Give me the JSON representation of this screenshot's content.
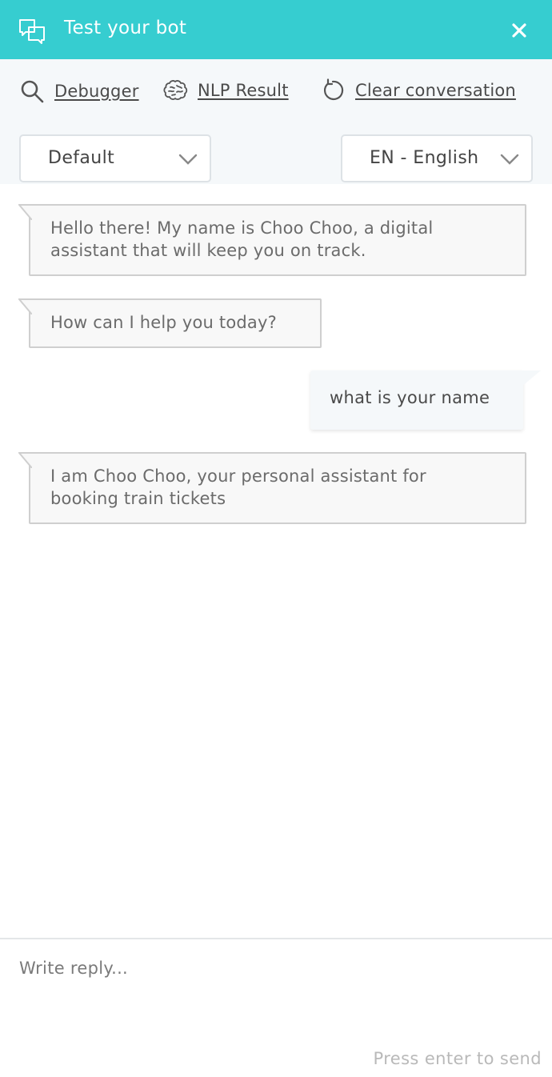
{
  "header": {
    "title": "Test your bot",
    "icon": "chat-bubbles-icon",
    "close_icon": "close-icon",
    "bg_color": "#36cdd0"
  },
  "toolbar": {
    "debugger_label": "Debugger",
    "debugger_icon": "search-icon",
    "nlp_label": "NLP Result",
    "nlp_icon": "brain-icon",
    "clear_label": "Clear conversation",
    "clear_icon": "refresh-icon"
  },
  "selectors": {
    "workspace": {
      "value": "Default",
      "icon": "chevron-down-icon"
    },
    "language": {
      "value": "EN - English",
      "icon": "chevron-down-icon"
    }
  },
  "conversation": {
    "messages": [
      {
        "from": "bot",
        "text": "Hello there! My name is Choo Choo, a digital\nassistant that will keep you on track."
      },
      {
        "from": "bot",
        "text": "How can I help you today?"
      },
      {
        "from": "user",
        "text": "what is your name"
      },
      {
        "from": "bot",
        "text": "I am Choo Choo, your personal assistant for\nbooking train tickets"
      }
    ]
  },
  "composer": {
    "placeholder": "Write reply...",
    "value": "",
    "hint": "Press enter to send"
  }
}
